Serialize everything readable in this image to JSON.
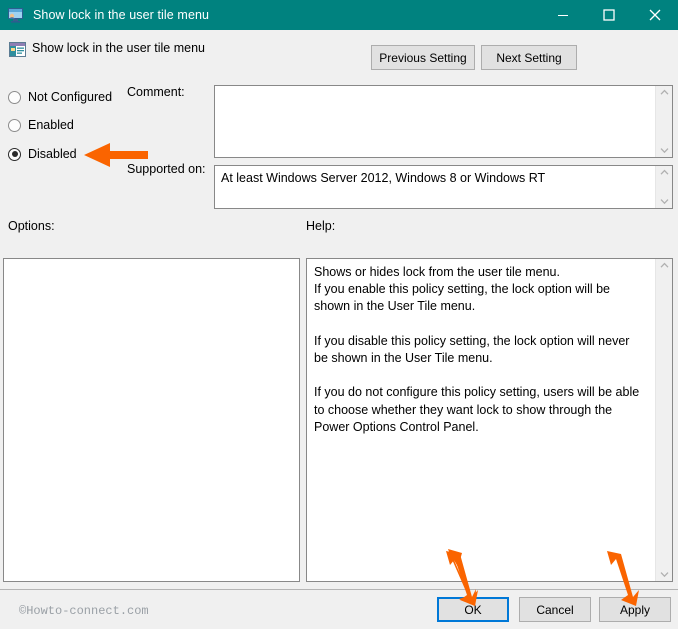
{
  "window": {
    "title": "Show lock in the user tile menu",
    "title_icon": "gpedit-monitor-icon",
    "controls": {
      "minimize": "minimize-icon",
      "maximize": "maximize-icon",
      "close": "close-icon"
    },
    "titlebar_color": "#00827f"
  },
  "header": {
    "policy_icon": "policy-setting-icon",
    "policy_title": "Show lock in the user tile menu",
    "previous_setting": "Previous Setting",
    "next_setting": "Next Setting"
  },
  "state_options": [
    {
      "label": "Not Configured",
      "selected": false
    },
    {
      "label": "Enabled",
      "selected": false
    },
    {
      "label": "Disabled",
      "selected": true
    }
  ],
  "fields": {
    "comment_label": "Comment:",
    "comment_value": "",
    "supported_label": "Supported on:",
    "supported_value": "At least Windows Server 2012, Windows 8 or Windows RT"
  },
  "panels": {
    "options_label": "Options:",
    "options_value": "",
    "help_label": "Help:",
    "help_text": "Shows or hides lock from the user tile menu.\nIf you enable this policy setting, the lock option will be shown in the User Tile menu.\n\nIf you disable this policy setting, the lock option will never be shown in the User Tile menu.\n\nIf you do not configure this policy setting, users will be able to choose whether they want lock to show through the Power Options Control Panel."
  },
  "footer": {
    "ok": "OK",
    "cancel": "Cancel",
    "apply": "Apply"
  },
  "watermark": "©Howto-connect.com",
  "annotations": {
    "color": "#fa6400",
    "arrow_disabled": "points to Disabled radio option",
    "arrow_ok": "points to OK button",
    "arrow_apply": "points to Apply button"
  }
}
